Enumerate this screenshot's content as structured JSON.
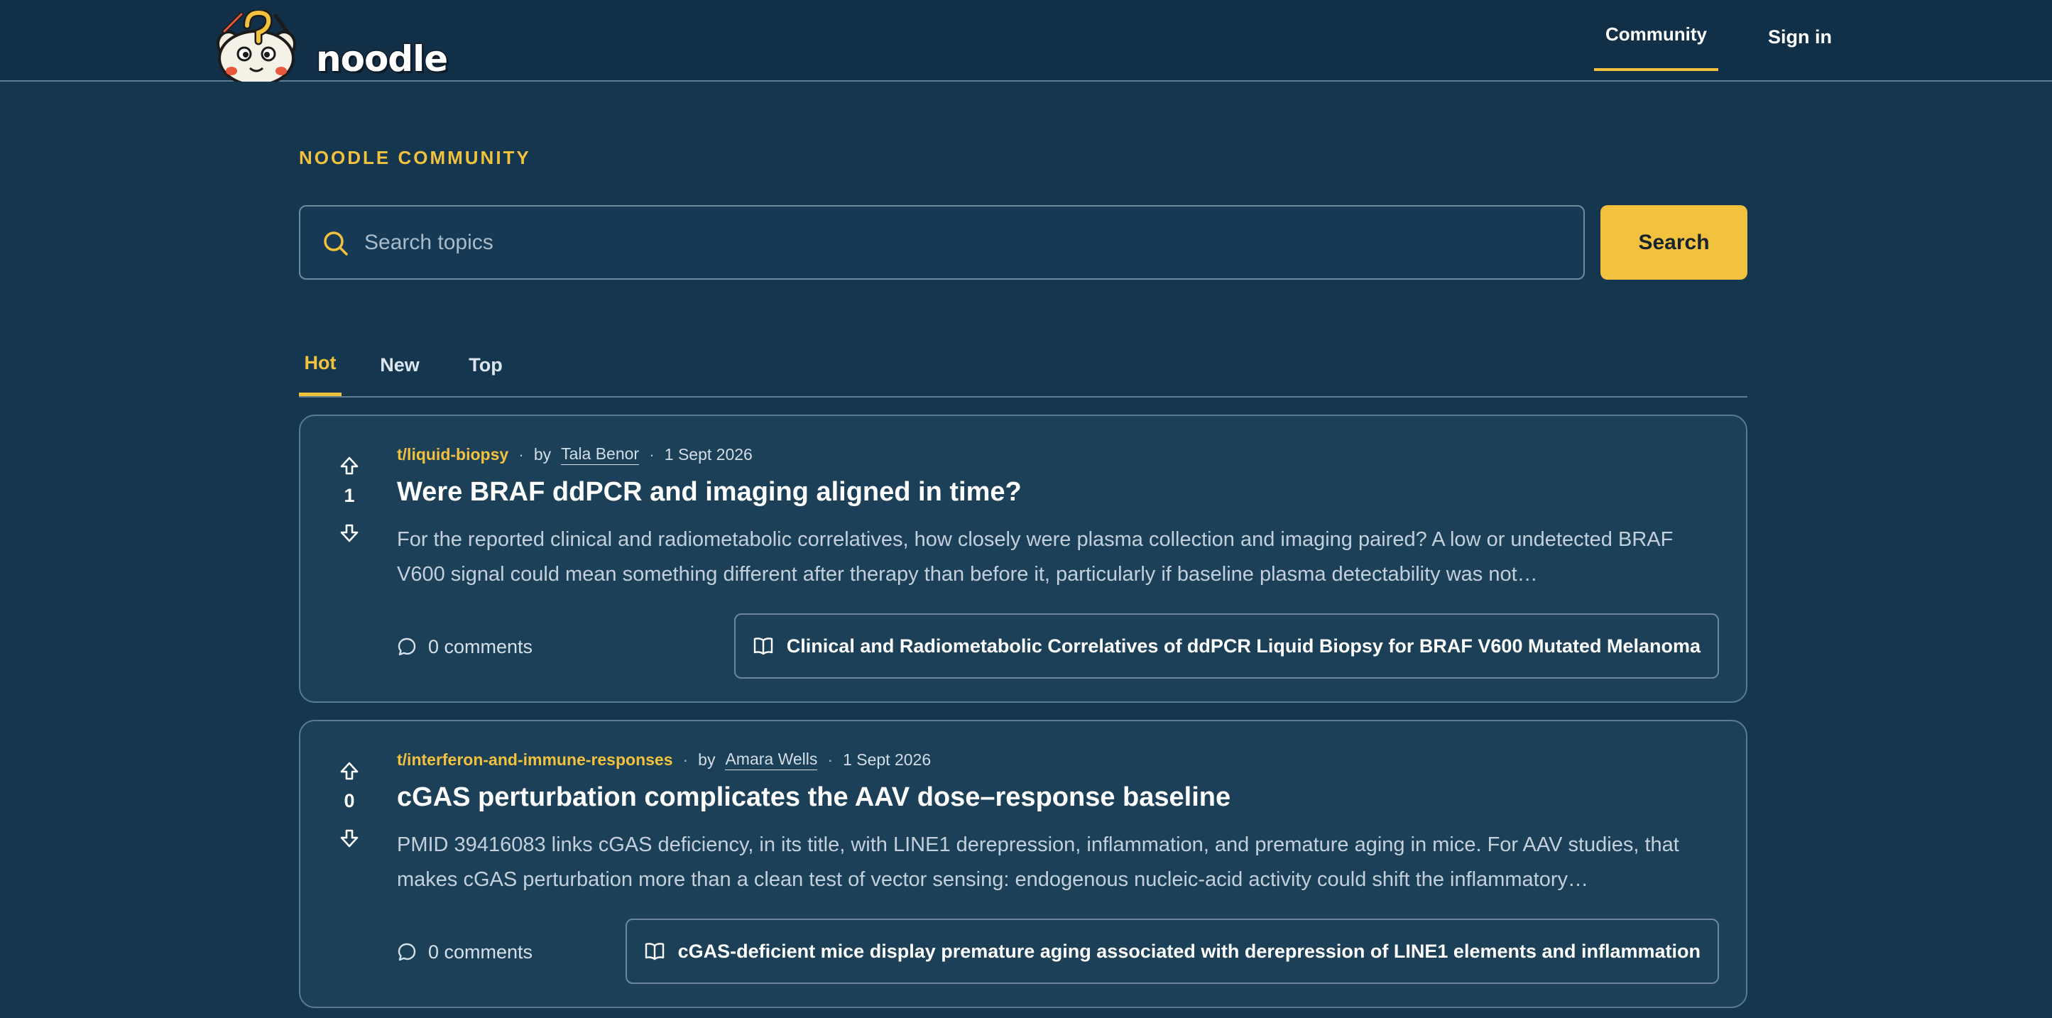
{
  "header": {
    "brand_name": "noodle",
    "nav": {
      "community": "Community",
      "sign_in": "Sign in"
    }
  },
  "page": {
    "section_label": "NOODLE COMMUNITY",
    "search": {
      "placeholder": "Search topics",
      "button_label": "Search"
    },
    "tabs": [
      {
        "label": "Hot",
        "active": true
      },
      {
        "label": "New",
        "active": false
      },
      {
        "label": "Top",
        "active": false
      }
    ]
  },
  "posts": [
    {
      "topic": "t/liquid-biopsy",
      "by": "by",
      "author": "Tala Benor",
      "date": "1 Sept 2026",
      "votes": "1",
      "title": "Were BRAF ddPCR and imaging aligned in time?",
      "excerpt": "For the reported clinical and radiometabolic correlatives, how closely were plasma collection and imaging paired? A low or undetected BRAF V600 signal could mean something different after therapy than before it, particularly if baseline plasma detectability was not…",
      "comments": "0 comments",
      "paper": "Clinical and Radiometabolic Correlatives of ddPCR Liquid Biopsy for BRAF V600 Mutated Melanoma"
    },
    {
      "topic": "t/interferon-and-immune-responses",
      "by": "by",
      "author": "Amara Wells",
      "date": "1 Sept 2026",
      "votes": "0",
      "title": "cGAS perturbation complicates the AAV dose–response baseline",
      "excerpt": "PMID 39416083 links cGAS deficiency, in its title, with LINE1 derepression, inflammation, and premature aging in mice. For AAV studies, that makes cGAS perturbation more than a clean test of vector sensing: endogenous nucleic-acid activity could shift the inflammatory…",
      "comments": "0 comments",
      "paper": "cGAS-deficient mice display premature aging associated with derepression of LINE1 elements and inflammation"
    }
  ],
  "colors": {
    "background": "#14364f",
    "header": "#112f47",
    "card": "#1c4058",
    "accent": "#f2c13d",
    "border": "#5b7b92"
  },
  "icons": [
    "search-icon",
    "arrow-up-icon",
    "arrow-down-icon",
    "comment-icon",
    "book-icon"
  ]
}
